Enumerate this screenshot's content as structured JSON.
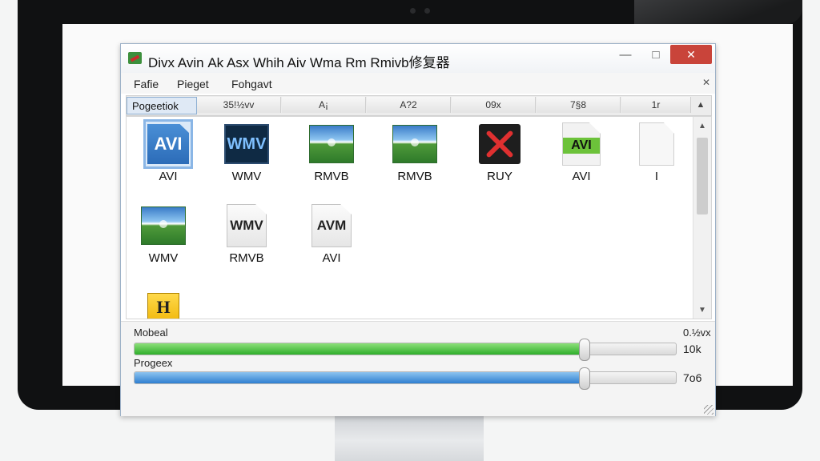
{
  "window": {
    "title": "Divx Avin Ak Asx Whih Aiv Wma Rm Rmivb修复器",
    "minimize_glyph": "—",
    "maximize_glyph": "□",
    "close_glyph": "✕"
  },
  "menu": {
    "items": [
      "Fafie",
      "Pieget",
      "Fohgavt"
    ],
    "close_glyph": "✕"
  },
  "columns": [
    "Pogeetiok",
    "35!½vv",
    "A¡",
    "A?2",
    "09x",
    "7§8",
    "1r"
  ],
  "files": [
    {
      "label": "AVI",
      "icon": "avi-file-icon",
      "text": "AVI",
      "selected": true
    },
    {
      "label": "WMV",
      "icon": "wmv-video-icon",
      "text": "WMV"
    },
    {
      "label": "RMVB",
      "icon": "landscape-video-icon"
    },
    {
      "label": "RMVB",
      "icon": "landscape-video-icon"
    },
    {
      "label": "RUY",
      "icon": "broken-file-icon"
    },
    {
      "label": "AVI",
      "icon": "avi-green-file-icon",
      "text": "AVI"
    },
    {
      "label": "I",
      "icon": "blank-file-icon"
    },
    {
      "label": "WMV",
      "icon": "landscape-video-icon"
    },
    {
      "label": "RMVB",
      "icon": "wmv-file-icon",
      "text": "WMV"
    },
    {
      "label": "AVI",
      "icon": "avm-file-icon",
      "text": "AVM"
    },
    {
      "label": "",
      "icon": "h-file-icon",
      "text": "H"
    }
  ],
  "bottom": {
    "slider1": {
      "label": "Mobeal",
      "value": 0.83,
      "value_text_top": "0.½vx",
      "value_text": "10k"
    },
    "slider2": {
      "label": "Progeex",
      "value": 0.83,
      "value_text": "7o6"
    }
  },
  "colors": {
    "green_fill": "#2fae2b",
    "blue_fill": "#2f7fd0",
    "close_button": "#c9443a",
    "selection": "#8ab6e6"
  }
}
